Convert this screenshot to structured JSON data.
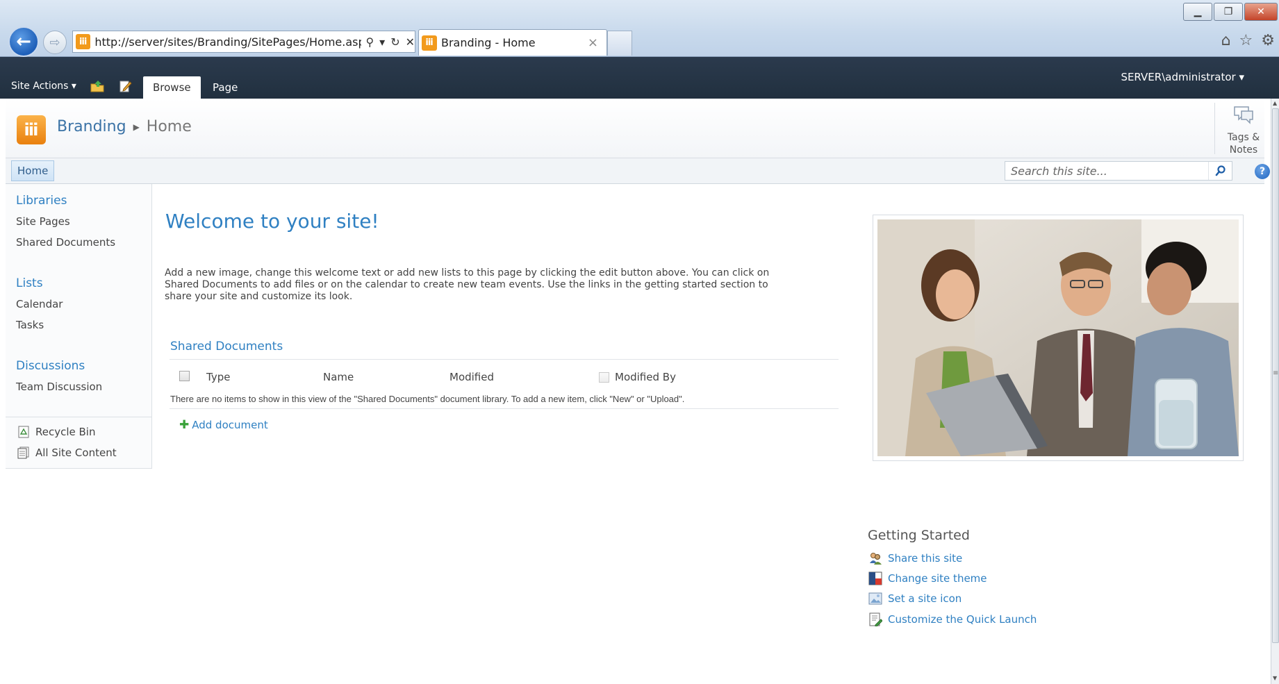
{
  "browser": {
    "url": "http://server/sites/Branding/SitePages/Home.aspx",
    "tab_title": "Branding - Home",
    "tab_close": "×",
    "window_controls": [
      "minimize-icon",
      "restore-icon",
      "close-icon"
    ],
    "toolbar_icons": [
      "home-icon",
      "favorites-star-icon",
      "tools-gear-icon"
    ]
  },
  "ribbon": {
    "site_actions": "Site Actions ▾",
    "tabs": [
      "Browse",
      "Page"
    ],
    "user": "SERVER\\administrator ▾"
  },
  "title_area": {
    "breadcrumb": [
      "Branding",
      "Home"
    ],
    "tags_label_1": "Tags &",
    "tags_label_2": "Notes"
  },
  "top_nav": {
    "home": "Home",
    "search_placeholder": "Search this site...",
    "help": "?"
  },
  "quick_launch": {
    "libraries": "Libraries",
    "site_pages": "Site Pages",
    "shared_documents": "Shared Documents",
    "lists": "Lists",
    "calendar": "Calendar",
    "tasks": "Tasks",
    "discussions": "Discussions",
    "team_discussion": "Team Discussion",
    "recycle_bin": "Recycle Bin",
    "all_site_content": "All Site Content"
  },
  "main": {
    "welcome": "Welcome to your site!",
    "intro_1": "Add a new image, change this welcome text or add new lists to this page by clicking the edit button above. You can click on",
    "intro_2": "Shared Documents to add files or on the calendar to create new team events. Use the links in the getting started section to",
    "intro_3": "share your site and customize its look.",
    "webpart_title": "Shared Documents",
    "columns": [
      "Type",
      "Name",
      "Modified",
      "Modified By"
    ],
    "empty_message": "There are no items to show in this view of the \"Shared Documents\" document library. To add a new item, click \"New\" or \"Upload\".",
    "add_document": "Add document"
  },
  "getting_started": {
    "title": "Getting Started",
    "links": [
      "Share this site",
      "Change site theme",
      "Set a site icon",
      "Customize the Quick Launch"
    ]
  },
  "colors": {
    "ribbon": "#2b3a4d",
    "link": "#2f80c2",
    "logo": "#f29a1c"
  }
}
